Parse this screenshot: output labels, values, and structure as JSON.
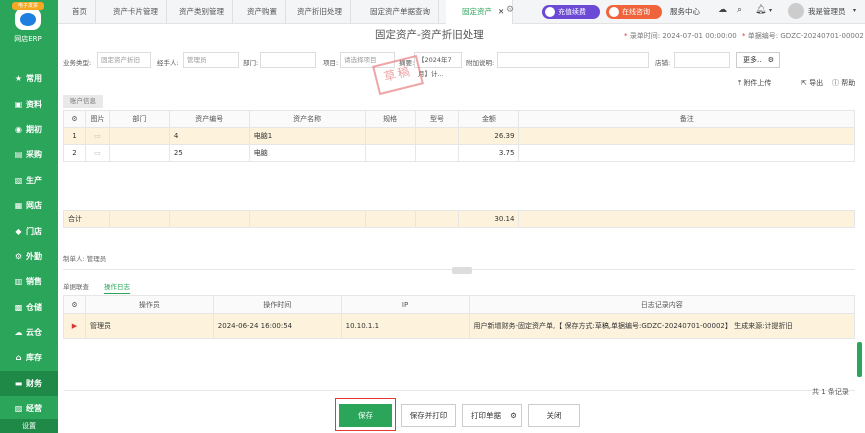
{
  "app": {
    "logo_badge": "电子发票",
    "logo_name": "网店ERP"
  },
  "sidebar": {
    "items": [
      {
        "label": "常用",
        "icon": "star-icon"
      },
      {
        "label": "资料",
        "icon": "id-card-icon"
      },
      {
        "label": "期初",
        "icon": "target-icon"
      },
      {
        "label": "采购",
        "icon": "cart-icon"
      },
      {
        "label": "生产",
        "icon": "doc-icon"
      },
      {
        "label": "网店",
        "icon": "bag-icon"
      },
      {
        "label": "门店",
        "icon": "pin-icon"
      },
      {
        "label": "外勤",
        "icon": "gear-icon"
      },
      {
        "label": "销售",
        "icon": "trend-icon"
      },
      {
        "label": "仓储",
        "icon": "box-icon"
      },
      {
        "label": "云仓",
        "icon": "cloud-icon"
      },
      {
        "label": "库存",
        "icon": "home-icon"
      },
      {
        "label": "财务",
        "icon": "wallet-icon"
      },
      {
        "label": "经营",
        "icon": "chart-icon"
      }
    ],
    "active_index": 12,
    "settings": "设置"
  },
  "tabs": [
    "首页",
    "资产卡片管理",
    "资产类别管理",
    "资产购置",
    "资产折旧处理",
    "固定资产单据查询",
    "固定资产"
  ],
  "topbar": {
    "renew": "充值续费",
    "consult": "在线咨询",
    "service": "服务中心",
    "user": "我是管理员"
  },
  "header": {
    "title": "固定资产-资产折旧处理",
    "date_label": "录单时间:",
    "date_value": "2024-07-01 00:00:00",
    "no_label": "单据编号:",
    "no_value": "GDZC-20240701-00002"
  },
  "form": {
    "biz_type_label": "业务类型:",
    "biz_type_value": "固定资产折旧",
    "handler_label": "经手人:",
    "handler_value": "管理员",
    "dept_label": "部门:",
    "dept_value": "",
    "project_label": "项目:",
    "project_placeholder": "请选择项目",
    "summary_label": "摘要:",
    "summary_value": "【2024年7月】计...",
    "note_label": "附加说明:",
    "note_value": "",
    "shop_label": "店铺:",
    "shop_value": "",
    "more": "更多..",
    "stamp": "草稿"
  },
  "toolbar": {
    "attach": "附件上传",
    "export": "导出",
    "help": "帮助"
  },
  "account_tab": "账户信息",
  "grid1": {
    "headers": [
      "图片",
      "部门",
      "资产编号",
      "资产名称",
      "规格",
      "型号",
      "金额",
      "备注"
    ],
    "rows": [
      {
        "idx": "1",
        "dept": "",
        "code": "4",
        "name": "电脑1",
        "spec": "",
        "model": "",
        "amount": "26.39",
        "note": ""
      },
      {
        "idx": "2",
        "dept": "",
        "code": "25",
        "name": "电脑",
        "spec": "",
        "model": "",
        "amount": "3.75",
        "note": ""
      }
    ],
    "total_label": "合计",
    "total_amount": "30.14"
  },
  "maker": "制单人: 管理员",
  "bottom_tabs": [
    "单据联查",
    "操作日志"
  ],
  "grid2": {
    "headers": [
      "操作员",
      "操作时间",
      "IP",
      "日志记录内容"
    ],
    "rows": [
      {
        "operator": "管理员",
        "time": "2024-06-24 16:00:54",
        "ip": "10.10.1.1",
        "content": "用户新增财务-固定资产单,【 保存方式:草稿,单据编号:GDZC-20240701-00002】 生成来源:计提折旧"
      }
    ]
  },
  "records": "共 1 条记录",
  "footer": {
    "save": "保存",
    "save_print": "保存并打印",
    "print": "打印单据",
    "close": "关闭"
  },
  "colors": {
    "brand": "#2aa55a",
    "renew": "#6c4ad6",
    "consult": "#f0643c"
  }
}
